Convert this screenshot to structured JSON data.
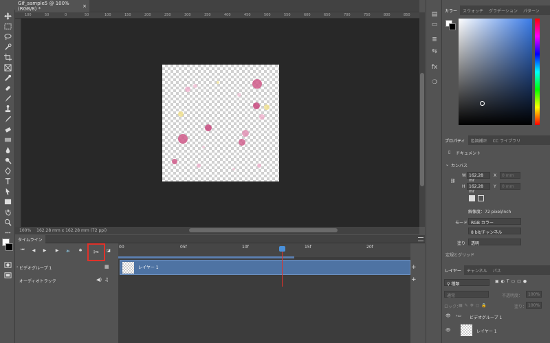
{
  "document": {
    "tab_title": "Gif_sample5 @ 100% (RGB/8) *",
    "close": "×",
    "zoom": "100%",
    "size_info": "162.28 mm x 162.28 mm (72 ppi)"
  },
  "ruler": {
    "marks": [
      "100",
      "50",
      "0",
      "50",
      "100",
      "150",
      "200",
      "250",
      "300",
      "350",
      "400",
      "450",
      "500",
      "550",
      "600",
      "650",
      "700",
      "750",
      "800",
      "850"
    ]
  },
  "timeline": {
    "tab": "タイムライン",
    "frame_marks": [
      "00",
      "05f",
      "10f",
      "15f",
      "20f"
    ],
    "video_group": "ビデオグループ 1",
    "audio_track": "オーディオトラック",
    "clip_label": "レイヤー 1",
    "add": "+",
    "playhead_frame": 13
  },
  "color_panel": {
    "tabs": [
      "カラー",
      "スウォッチ",
      "グラデーション",
      "パターン"
    ]
  },
  "properties": {
    "tabs": [
      "プロパティ",
      "色調補正",
      "CC ライブラリ"
    ],
    "doc_label": "ドキュメント",
    "canvas_header": "カンバス",
    "w_label": "W",
    "w_value": "162.28 mr",
    "x_label": "X",
    "x_placeholder": "0 mm",
    "h_label": "H",
    "h_value": "162.28 mr",
    "y_label": "Y",
    "y_placeholder": "0 mm",
    "resolution": "解像度：72 pixel/inch",
    "mode_label": "モード",
    "mode_value": "RGB カラー",
    "depth_value": "8 bit/チャンネル",
    "fill_label": "塗り",
    "fill_value": "透明",
    "cut_header": "定規とグリッド"
  },
  "layers": {
    "tabs": [
      "レイヤー",
      "チャンネル",
      "パス"
    ],
    "filter": "種類",
    "blend": "通常",
    "opacity_label": "不透明度：",
    "opacity": "100%",
    "lock_label": "ロック：",
    "fill_label": "塗り：",
    "fill": "100%",
    "items": [
      "ビデオグループ 1",
      "レイヤー 1"
    ]
  },
  "colors": {
    "accent": "#4e73a3",
    "highlight": "#e0322a"
  }
}
